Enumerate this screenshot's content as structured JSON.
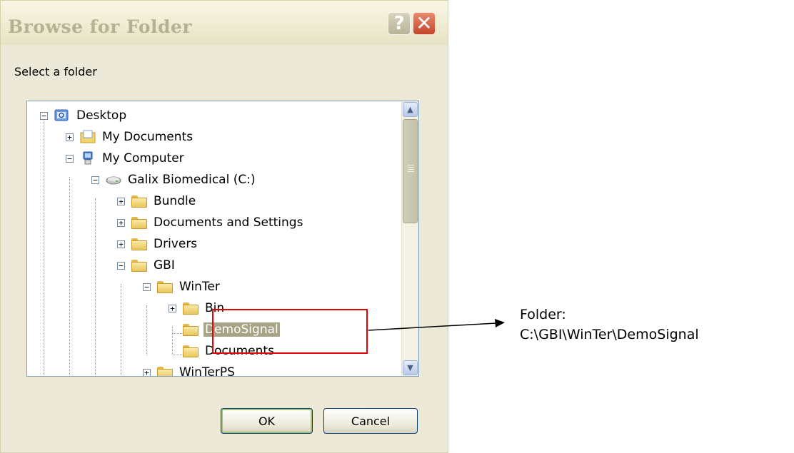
{
  "dialog": {
    "title": "Browse for Folder",
    "help_glyph": "?",
    "close_glyph": "✕",
    "prompt": "Select a folder",
    "ok_label": "OK",
    "cancel_label": "Cancel"
  },
  "tree": {
    "items": [
      {
        "label": "Desktop",
        "expander": "−",
        "icon": "desktop-icon"
      },
      {
        "label": "My Documents",
        "expander": "+",
        "icon": "my-documents-icon"
      },
      {
        "label": "My Computer",
        "expander": "−",
        "icon": "my-computer-icon"
      },
      {
        "label": "Galix Biomedical (C:)",
        "expander": "−",
        "icon": "drive-icon"
      },
      {
        "label": "Bundle",
        "expander": "+",
        "icon": "folder-icon"
      },
      {
        "label": "Documents and Settings",
        "expander": "+",
        "icon": "folder-icon"
      },
      {
        "label": "Drivers",
        "expander": "+",
        "icon": "folder-icon"
      },
      {
        "label": "GBI",
        "expander": "−",
        "icon": "folder-icon"
      },
      {
        "label": "WinTer",
        "expander": "−",
        "icon": "folder-icon"
      },
      {
        "label": "Bin",
        "expander": "+",
        "icon": "folder-icon"
      },
      {
        "label": "DemoSignal",
        "expander": "",
        "icon": "folder-open-icon",
        "selected": true
      },
      {
        "label": "Documents",
        "expander": "",
        "icon": "folder-icon"
      },
      {
        "label": "WinTerPS",
        "expander": "+",
        "icon": "folder-icon"
      }
    ]
  },
  "annotation": {
    "line1": "Folder:",
    "line2": "C:\\GBI\\WinTer\\DemoSignal",
    "color": "#e60000"
  },
  "colors": {
    "dialog_bg": "#ece9d8",
    "selection": "#a7a486"
  }
}
